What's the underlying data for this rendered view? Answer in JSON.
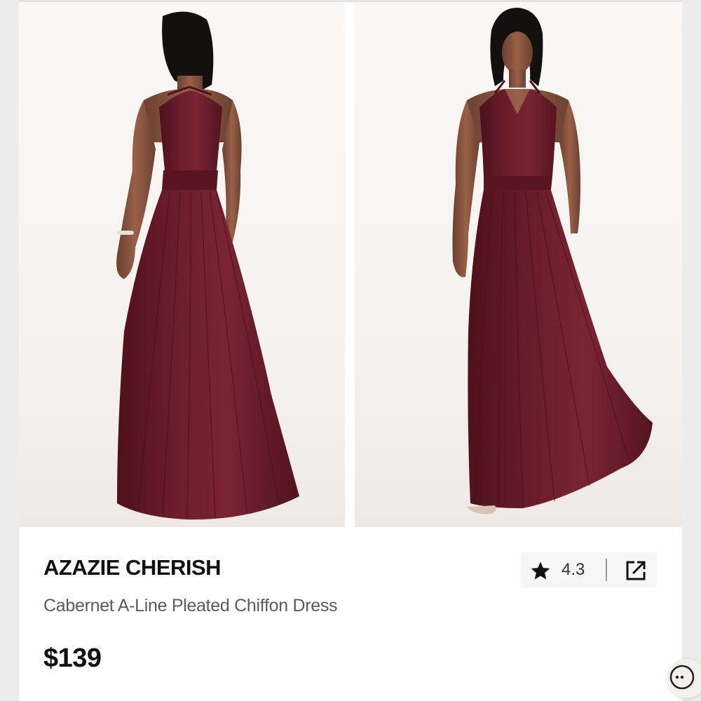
{
  "images": [
    {
      "name": "back-view",
      "alt": "Model wearing dress, back view"
    },
    {
      "name": "front-view",
      "alt": "Model wearing dress, front view"
    }
  ],
  "product": {
    "brand": "AZAZIE CHERISH",
    "name": "Cabernet A-Line Pleated Chiffon Dress",
    "price": "$139"
  },
  "rating": {
    "icon": "star-icon",
    "value": "4.3"
  },
  "actions": {
    "open_icon": "external-link-icon",
    "more_icon": "more-options-icon"
  },
  "colors": {
    "dress": "#6e1f2c",
    "dress_dark": "#4e111c",
    "text_primary": "#111111",
    "text_secondary": "#5b5b5b",
    "pill_bg": "#f6f6f6"
  }
}
